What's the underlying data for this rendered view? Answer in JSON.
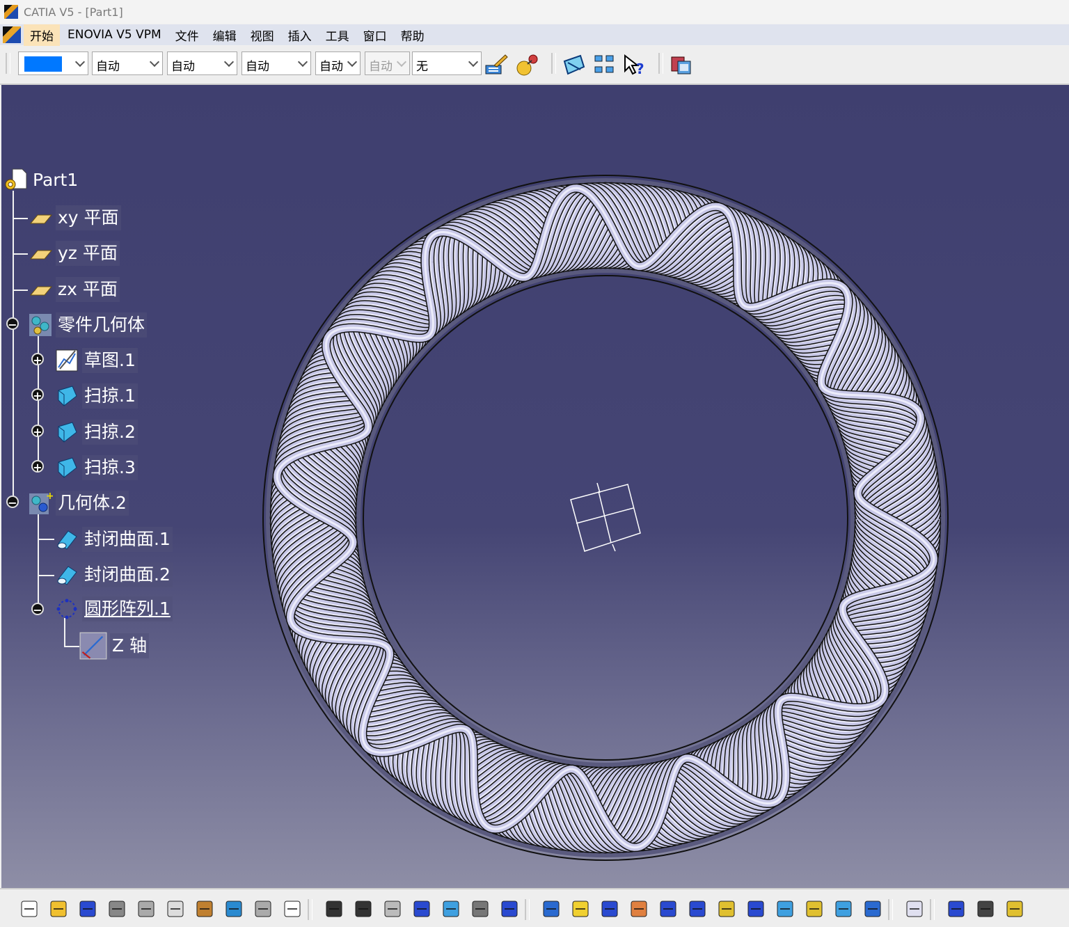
{
  "window": {
    "title": "CATIA V5 - [Part1]"
  },
  "menubar": {
    "items": [
      "开始",
      "ENOVIA V5 VPM",
      "文件",
      "编辑",
      "视图",
      "插入",
      "工具",
      "窗口",
      "帮助"
    ]
  },
  "toolbar_top": {
    "color_value": "#0078ff",
    "combos": [
      "自动",
      "自动",
      "自动",
      "自动",
      "自动",
      "无"
    ],
    "icons": [
      "painter-brush-icon",
      "apply-material-icon",
      "sketch-plane-icon",
      "quick-view-icon",
      "whats-this-icon",
      "catalog-icon"
    ]
  },
  "tree": {
    "root": "Part1",
    "xy_plane": "xy 平面",
    "yz_plane": "yz 平面",
    "zx_plane": "zx 平面",
    "part_body": "零件几何体",
    "sketch1": "草图.1",
    "rib1": "扫掠.1",
    "rib2": "扫掠.2",
    "rib3": "扫掠.3",
    "body2": "几何体.2",
    "close_surface1": "封闭曲面.1",
    "close_surface2": "封闭曲面.2",
    "circ_pattern1": "圆形阵列.1",
    "z_axis": "Z 轴"
  },
  "model": {
    "description_color": "#c8c8e8",
    "strand_count": 24
  },
  "toolbar_bottom": {
    "icons": [
      "new-icon",
      "open-icon",
      "save-icon",
      "print-icon",
      "cut-icon",
      "copy-icon",
      "paste-icon",
      "undo-icon",
      "redo-icon",
      "whats-this-icon",
      "formula-icon",
      "comment-icon",
      "link-icon",
      "table-icon",
      "tree-expand-icon",
      "lock-icon",
      "parameter-icon",
      "fly-mode-icon",
      "fit-all-icon",
      "pan-icon",
      "rotate-icon",
      "zoom-in-icon",
      "zoom-out-icon",
      "normal-view-icon",
      "multi-view-icon",
      "iso-view-icon",
      "shading-icon",
      "hide-show-icon",
      "swap-space-icon",
      "catalog-browser-icon",
      "measure-between-icon",
      "measure-item-icon",
      "measure-inertia-icon"
    ]
  }
}
